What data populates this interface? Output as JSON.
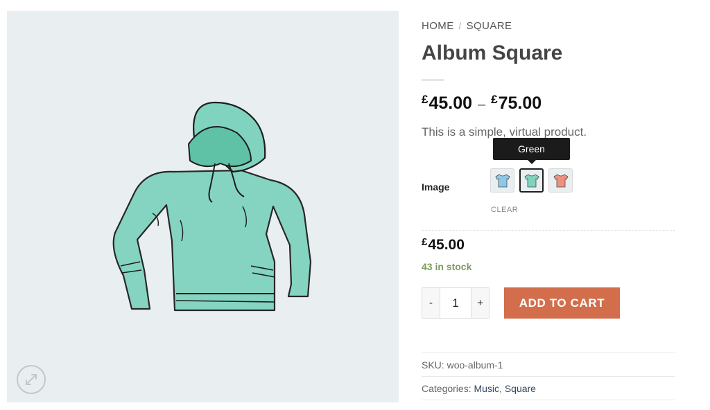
{
  "breadcrumb": {
    "home": "HOME",
    "separator": "/",
    "category": "SQUARE"
  },
  "product": {
    "title": "Album Square",
    "currency_symbol": "£",
    "price_min": "45.00",
    "price_dash": "–",
    "price_max": "75.00",
    "description": "This is a simple, virtual product."
  },
  "variation": {
    "attribute_label": "Image",
    "tooltip": "Green",
    "clear_label": "CLEAR",
    "swatches": [
      {
        "color": "#8ec8e6"
      },
      {
        "color": "#7fd3bf",
        "selected": true
      },
      {
        "color": "#f0917f"
      }
    ]
  },
  "selected": {
    "price": "45.00",
    "stock": "43 in stock"
  },
  "cart": {
    "minus": "-",
    "quantity": "1",
    "plus": "+",
    "add_label": "ADD TO CART"
  },
  "meta": {
    "sku_label": "SKU:",
    "sku": "woo-album-1",
    "categories_label": "Categories:",
    "categories": [
      "Music",
      "Square"
    ],
    "categories_sep": ","
  },
  "colors": {
    "accent": "#d26e4b",
    "stock_green": "#7a9c59",
    "link": "#334862",
    "hoodie": "#7fd3bf"
  },
  "icons": {
    "zoom": "expand-arrows-icon"
  }
}
